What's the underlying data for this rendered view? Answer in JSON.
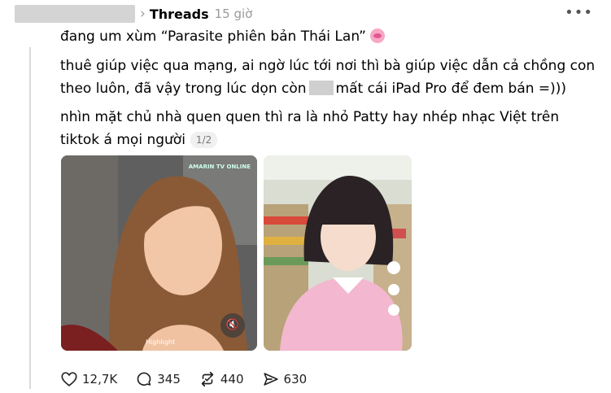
{
  "header": {
    "community": "Threads",
    "time": "15 giờ",
    "more": "•••"
  },
  "post": {
    "line1": "đang um xùm “Parasite phiên bản Thái Lan”",
    "line2a": "thuê giúp việc qua mạng, ai ngờ lúc tới nơi thì bà giúp việc dẫn cả chồng con theo luôn, đã vậy trong lúc dọn còn",
    "line2b": "mất cái iPad Pro để đem bán =)))",
    "line3": "nhìn mặt chủ nhà quen quen thì ra là nhỏ Patty hay nhép nhạc Việt trên tiktok á mọi người",
    "pager": "1/2"
  },
  "media": {
    "image1": {
      "watermark": "AMARIN TV ONLINE",
      "label": "Highlight"
    },
    "image2": {}
  },
  "actions": {
    "likes": "12,7K",
    "comments": "345",
    "reposts": "440",
    "shares": "630"
  }
}
